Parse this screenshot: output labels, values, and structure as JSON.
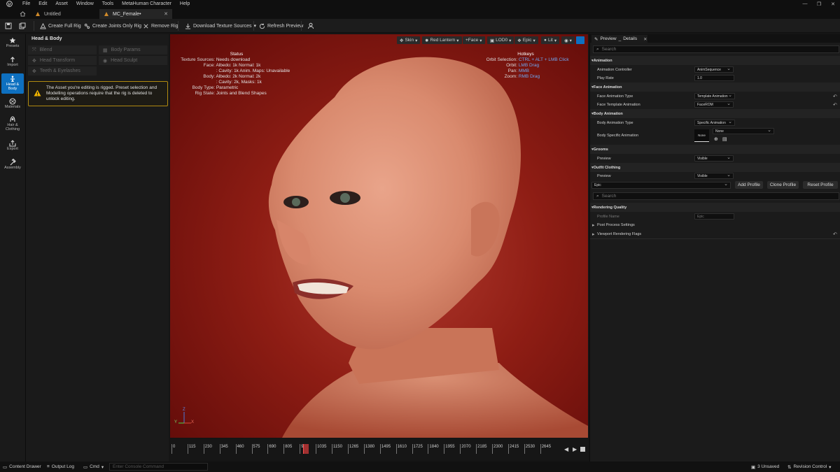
{
  "menu": [
    "File",
    "Edit",
    "Asset",
    "Window",
    "Tools",
    "MetaHuman Character",
    "Help"
  ],
  "tabs": [
    {
      "label": "Untitled"
    },
    {
      "label": "MC_Female•"
    }
  ],
  "toolbar": {
    "create_full_rig": "Create Full Rig",
    "create_joints_only_rig": "Create Joints Only Rig",
    "remove_rig": "Remove Rig",
    "download_texture_sources": "Download Texture Sources",
    "refresh_preview": "Refresh Preview"
  },
  "rail": [
    {
      "label": "Presets",
      "icon": "star-icon"
    },
    {
      "label": "Import",
      "icon": "import-icon"
    },
    {
      "label": "Head & Body",
      "icon": "figure-icon",
      "active": true
    },
    {
      "label": "Materials",
      "icon": "materials-icon"
    },
    {
      "label": "Hair & Clothing",
      "icon": "hair-icon"
    },
    {
      "label": "Export",
      "icon": "export-icon"
    },
    {
      "label": "Assembly",
      "icon": "hammer-icon"
    }
  ],
  "left_panel": {
    "title": "Head & Body",
    "blend": "Blend",
    "body_params": "Body Params",
    "head_transform": "Head Transform",
    "head_sculpt": "Head Sculpt",
    "teeth_eyelashes": "Teeth & Eyelashes",
    "warning": "The Asset you're editing is rigged. Preset selection and Modelling operations require that the rig is deleted to unlock editing."
  },
  "viewport": {
    "tools": {
      "skin": "Skin",
      "lighting": "Red Lantern",
      "face": "+Face",
      "lod": "LOD0",
      "quality": "Epic",
      "lit": "Lit"
    },
    "status": {
      "title": "Status",
      "texture_sources_label": "Texture Sources:",
      "texture_sources_value": "Needs download",
      "face_label": "Face:",
      "face_value1": "Albedo: 1k Normal: 1k",
      "face_value2": ": Cavity: 1k Anim. Maps: Unavailable",
      "body_label": "Body:",
      "body_value1": "Albedo: 2k Normal: 2k",
      "body_value2": ": Cavity: 2k, Masks: 1k",
      "body_type_label": "Body Type:",
      "body_type_value": "Parametric",
      "rig_state_label": "Rig State:",
      "rig_state_value": "Joints and Blend Shapes"
    },
    "hotkeys": {
      "title": "Hotkeys",
      "orbit_selection_label": "Orbit Selection:",
      "orbit_selection_value": "CTRL + ALT + LMB Click",
      "orbit_label": "Orbit:",
      "orbit_value": "LMB Drag",
      "pan_label": "Pan:",
      "pan_value": "MMB",
      "zoom_label": "Zoom:",
      "zoom_value": "RMB Drag"
    },
    "axis": {
      "z": "Z",
      "y": "Y",
      "x": "X"
    }
  },
  "timeline": {
    "ticks": [
      "0",
      "115",
      "230",
      "345",
      "460",
      "575",
      "690",
      "805",
      "920",
      "1035",
      "1150",
      "1265",
      "1380",
      "1495",
      "1610",
      "1725",
      "1840",
      "1955",
      "2070",
      "2185",
      "2300",
      "2415",
      "2530",
      "2645"
    ],
    "playhead_value": "920"
  },
  "details": {
    "tab_preview": "Preview",
    "tab_details": "Details",
    "search_placeholder": "Search",
    "animation": "Animation",
    "animation_controller_label": "Animation Controller",
    "animation_controller_value": "AnimSequence",
    "play_rate_label": "Play Rate",
    "play_rate_value": "1.0",
    "face_animation": "Face Animation",
    "face_animation_type_label": "Face Animation Type",
    "face_animation_type_value": "Template Animation",
    "face_template_animation_label": "Face Template Animation",
    "face_template_animation_value": "FaceROM",
    "body_animation": "Body Animation",
    "body_animation_type_label": "Body Animation Type",
    "body_animation_type_value": "Specific Animation",
    "body_specific_animation_label": "Body Specific Animation",
    "body_specific_thumb": "None",
    "body_specific_value": "None",
    "grooms": "Grooms",
    "grooms_preview_label": "Preview",
    "grooms_preview_value": "Visible",
    "outfit_clothing": "Outfit Clothing",
    "outfit_preview_label": "Preview",
    "outfit_preview_value": "Visible",
    "profile_select": "Epic",
    "add_profile": "Add Profile",
    "clone_profile": "Clone Profile",
    "reset_profile": "Reset Profile",
    "rendering_quality": "Rendering Quality",
    "profile_name_label": "Profile Name",
    "profile_name_value": "Epic",
    "post_process_settings": "Post Process Settings",
    "viewport_rendering_flags": "Viewport Rendering Flags"
  },
  "statusbar": {
    "content_drawer": "Content Drawer",
    "output_log": "Output Log",
    "cmd": "Cmd",
    "console_placeholder": "Enter Console Command",
    "unsaved": "3 Unsaved",
    "revision_control": "Revision Control"
  }
}
